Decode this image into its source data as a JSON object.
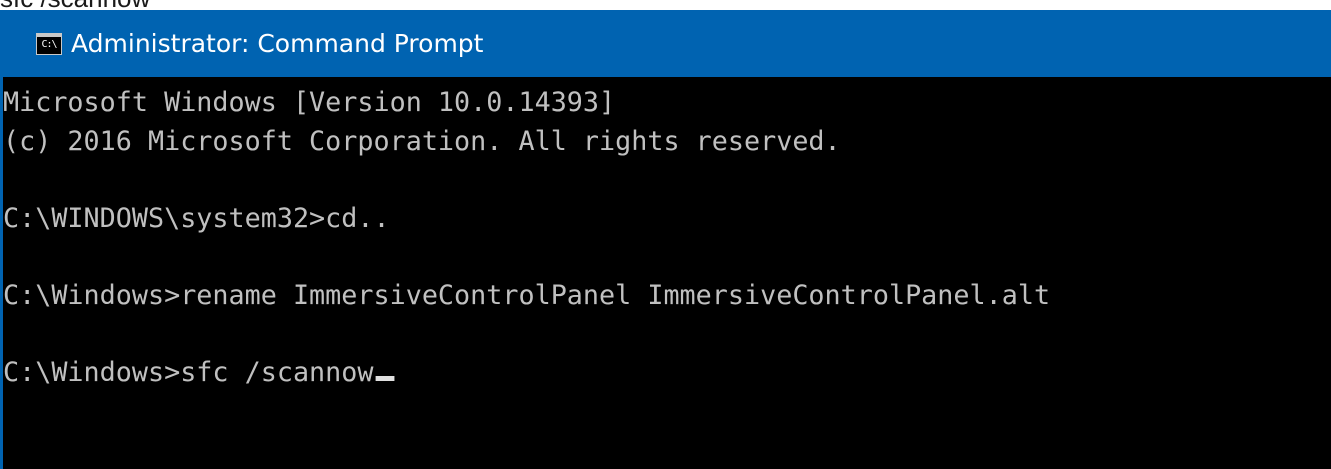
{
  "caption": "sfc /scannow",
  "window": {
    "title": "Administrator: Command Prompt",
    "icon": "command-prompt-icon",
    "icon_text": "C:\\"
  },
  "console": {
    "lines": [
      "Microsoft Windows [Version 10.0.14393]",
      "(c) 2016 Microsoft Corporation. All rights reserved.",
      "",
      "C:\\WINDOWS\\system32>cd..",
      "",
      "C:\\Windows>rename ImmersiveControlPanel ImmersiveControlPanel.alt",
      "",
      "C:\\Windows>sfc /scannow"
    ]
  },
  "colors": {
    "titlebar": "#0063b1",
    "console_bg": "#000000",
    "console_text": "#c0c0c0"
  }
}
